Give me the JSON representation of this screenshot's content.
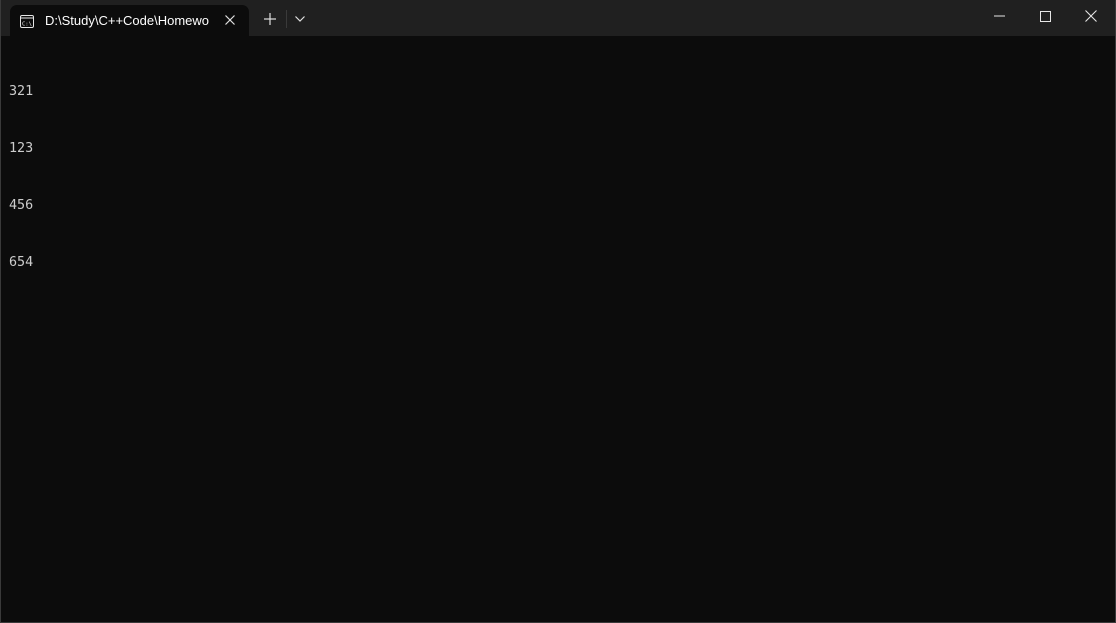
{
  "window": {
    "tab": {
      "title": "D:\\Study\\C++Code\\Homewo",
      "icon": "console-icon"
    },
    "buttons": {
      "new_tab_icon": "plus-icon",
      "dropdown_icon": "chevron-down-icon",
      "minimize_icon": "minimize-icon",
      "maximize_icon": "maximize-icon",
      "close_icon": "close-icon"
    },
    "colors": {
      "titlebar": "#202020",
      "background": "#0c0c0c",
      "text": "#cccccc"
    }
  },
  "console": {
    "lines": [
      "321",
      "123",
      "456",
      "654"
    ]
  }
}
